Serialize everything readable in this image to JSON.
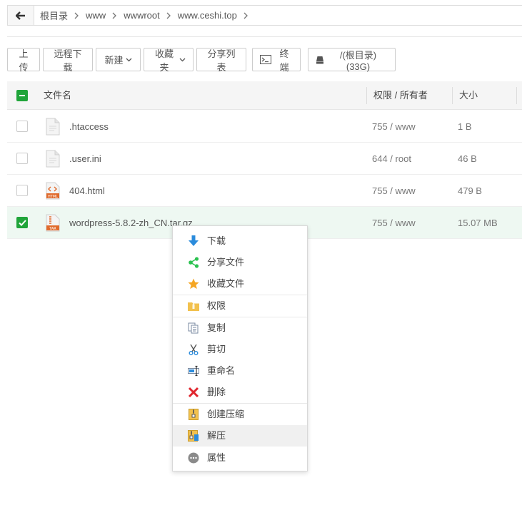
{
  "breadcrumb": {
    "items": [
      "根目录",
      "www",
      "wwwroot",
      "www.ceshi.top"
    ]
  },
  "toolbar": {
    "upload": "上传",
    "remote_download": "远程下载",
    "new": "新建",
    "favorites": "收藏夹",
    "share_list": "分享列表",
    "terminal": "终端",
    "disk": "/(根目录) (33G)"
  },
  "table": {
    "headers": {
      "name": "文件名",
      "perm": "权限 / 所有者",
      "size": "大小"
    },
    "rows": [
      {
        "name": ".htaccess",
        "perm": "755 / www",
        "size": "1 B",
        "icon": "file-icon",
        "selected": false
      },
      {
        "name": ".user.ini",
        "perm": "644 / root",
        "size": "46 B",
        "icon": "file-icon",
        "selected": false
      },
      {
        "name": "404.html",
        "perm": "755 / www",
        "size": "479 B",
        "icon": "html-file-icon",
        "selected": false
      },
      {
        "name": "wordpress-5.8.2-zh_CN.tar.gz",
        "perm": "755 / www",
        "size": "15.07 MB",
        "icon": "tar-file-icon",
        "selected": true
      }
    ]
  },
  "context_menu": {
    "download": "下载",
    "share_file": "分享文件",
    "favorite_file": "收藏文件",
    "permission": "权限",
    "copy": "复制",
    "cut": "剪切",
    "rename": "重命名",
    "delete": "删除",
    "compress": "创建压缩",
    "extract": "解压",
    "properties": "属性"
  },
  "colors": {
    "accent_green": "#20a53a",
    "selected_row": "#eef8f2",
    "delete_red": "#e0262e",
    "share_green": "#2bc250",
    "star_yellow": "#f5a623",
    "download_blue": "#2a8bdc"
  }
}
